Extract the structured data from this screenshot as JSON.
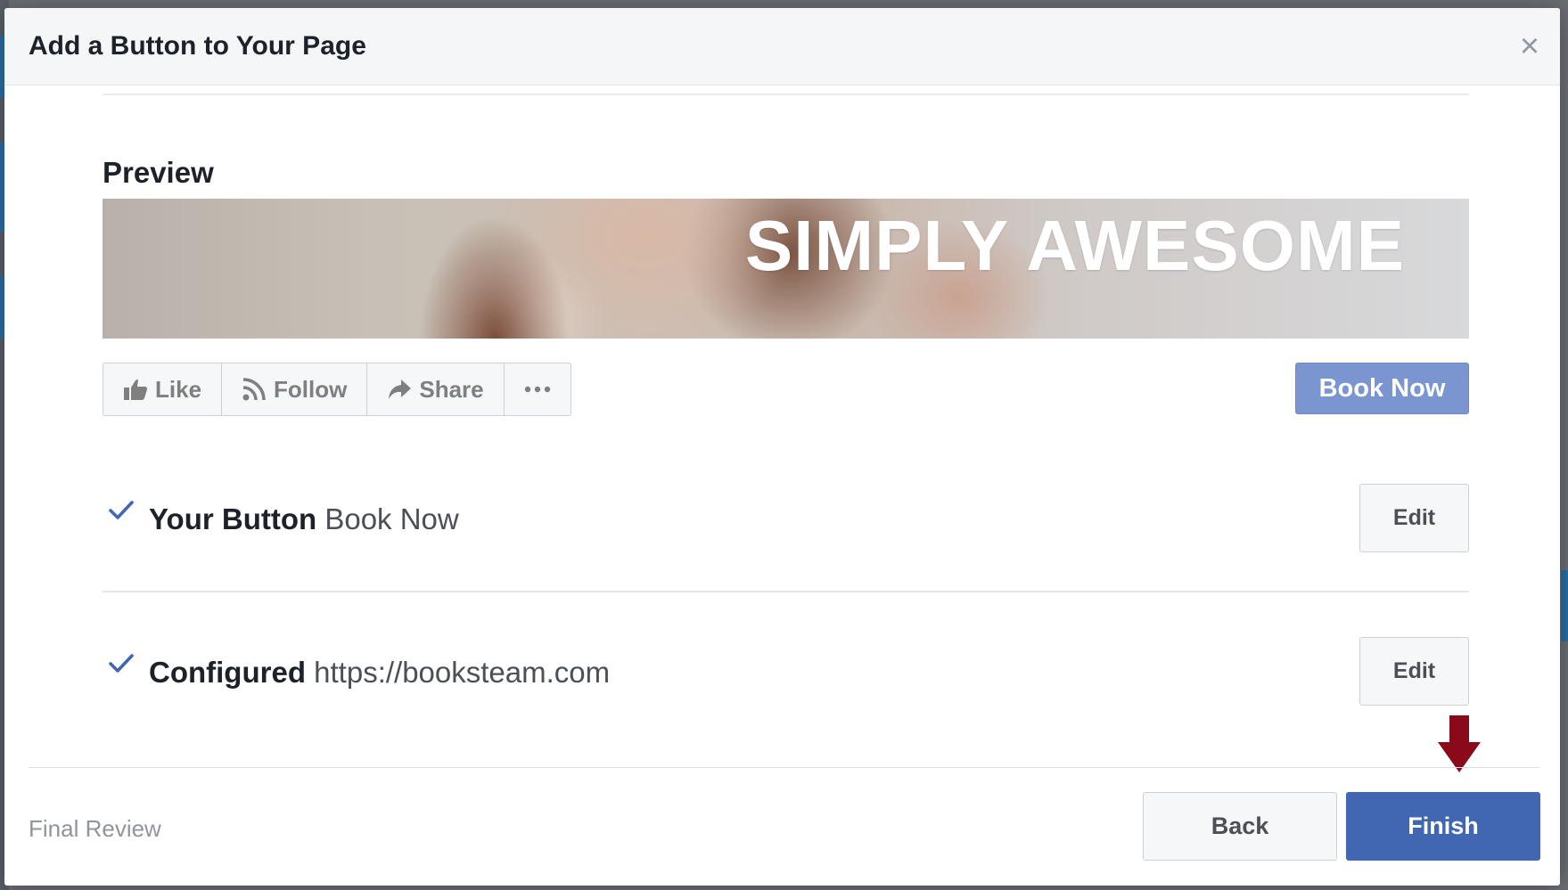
{
  "dialog": {
    "title": "Add a Button to Your Page",
    "close_label": "×"
  },
  "preview": {
    "heading": "Preview",
    "cover_text": "SIMPLY AWESOME",
    "actions": [
      {
        "label": "Like",
        "icon": "thumbs-up-icon"
      },
      {
        "label": "Follow",
        "icon": "rss-icon"
      },
      {
        "label": "Share",
        "icon": "share-arrow-icon"
      },
      {
        "label": "",
        "icon": "more-dots-icon"
      }
    ],
    "cta_label": "Book Now"
  },
  "steps": [
    {
      "label": "Your Button",
      "value": "Book Now",
      "edit_label": "Edit",
      "icon": "checkmark-icon"
    },
    {
      "label": "Configured",
      "value": "https://booksteam.com",
      "edit_label": "Edit",
      "icon": "checkmark-icon"
    }
  ],
  "footer": {
    "step_label": "Final Review",
    "back_label": "Back",
    "finish_label": "Finish"
  },
  "colors": {
    "accent": "#4267b2",
    "cta_preview": "#7b95d0",
    "check": "#4267b2",
    "annotation_arrow": "#8b0a1a"
  }
}
